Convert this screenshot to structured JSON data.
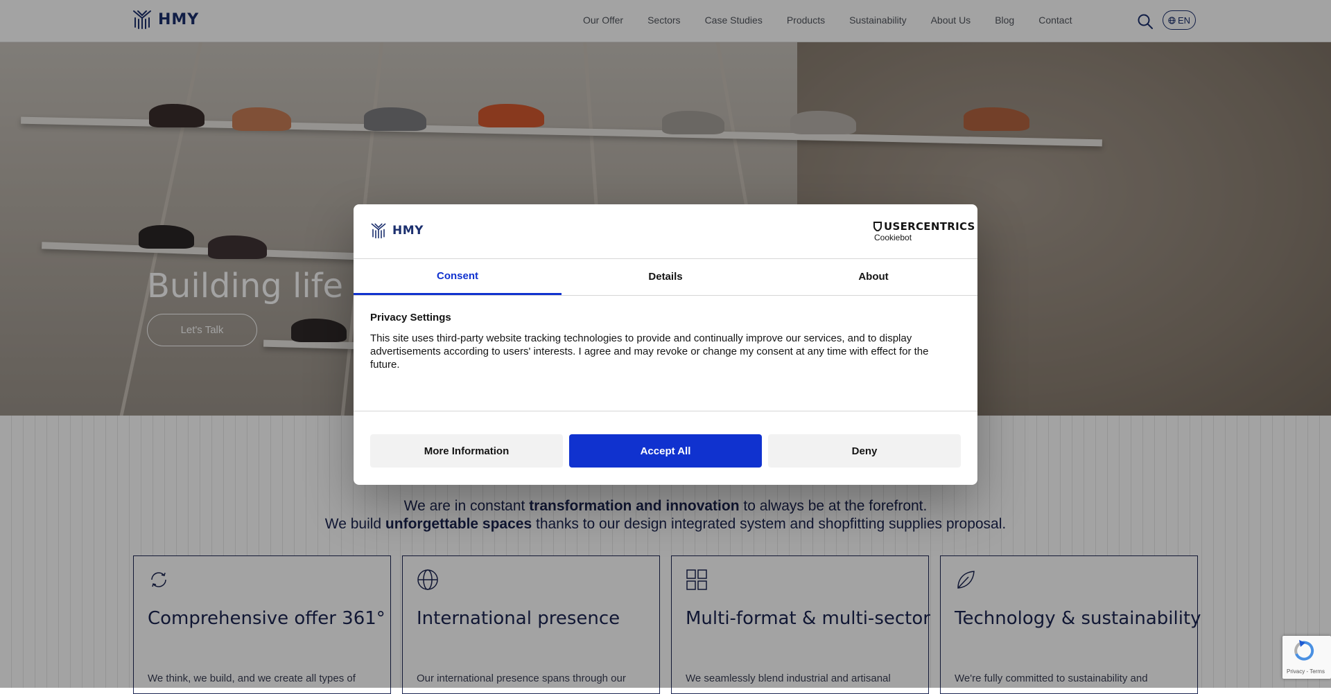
{
  "header": {
    "brand": "HMY",
    "nav": [
      "Our Offer",
      "Sectors",
      "Case Studies",
      "Products",
      "Sustainability",
      "About Us",
      "Blog",
      "Contact"
    ],
    "language": "EN",
    "icons": {
      "search": "search-icon",
      "language": "globe-icon",
      "logo": "hmy-logo-icon"
    }
  },
  "hero": {
    "title": "Building life int",
    "cta_label": "Let's Talk"
  },
  "intro": {
    "line1_pre": "We are in constant ",
    "line1_hl": "transformation and innovation",
    "line1_post": " to always be at the forefront.",
    "line2_pre": "We build ",
    "line2_hl": "unforgettable spaces",
    "line2_post": " thanks to our design integrated system and shopfitting supplies proposal."
  },
  "cards": [
    {
      "title": "Comprehensive offer 361°",
      "text": "We think, we build, and we create all types of",
      "icon": "refresh-icon"
    },
    {
      "title": "International presence",
      "text": "Our international presence spans through our",
      "icon": "globe-icon"
    },
    {
      "title": "Multi-format & multi-sector",
      "text": "We seamlessly blend industrial and artisanal",
      "icon": "grid-icon"
    },
    {
      "title": "Technology & sustainability",
      "text": "We're fully committed to sustainability and",
      "icon": "leaf-icon"
    }
  ],
  "cookie_dialog": {
    "brand": "HMY",
    "provider": "USERCENTRICS",
    "provider_sub": "Cookiebot",
    "tabs": [
      "Consent",
      "Details",
      "About"
    ],
    "active_tab": "Consent",
    "heading": "Privacy Settings",
    "body": "This site uses third-party website tracking technologies to provide and continually improve our services, and to display advertisements according to users' interests. I agree and may revoke or change my consent at any time with effect for the future.",
    "buttons": {
      "more_info": "More Information",
      "accept": "Accept All",
      "deny": "Deny"
    }
  },
  "recaptcha": {
    "text": "Privacy - Terms"
  },
  "colors": {
    "brand_navy": "#1b2f6e",
    "accent_blue": "#1032cf",
    "text_dark": "#141414"
  }
}
